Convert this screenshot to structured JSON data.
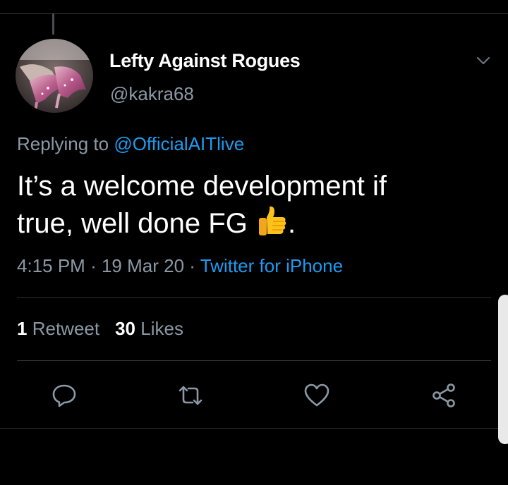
{
  "author": {
    "display_name": "Lefty Against Rogues",
    "handle": "@kakra68",
    "avatar_icon": "profile-photo-glitter-heels"
  },
  "reply": {
    "prefix": "Replying to",
    "mention": "@OfficialAITlive"
  },
  "tweet": {
    "line1": "It’s a welcome development if",
    "line2_text": "true, well done FG",
    "emoji": "thumbs-up-icon",
    "line2_suffix": "."
  },
  "meta": {
    "time": "4:15 PM",
    "separator1": "·",
    "date": "19 Mar 20",
    "separator2": "·",
    "source": "Twitter for iPhone"
  },
  "stats": {
    "retweet_count": "1",
    "retweet_label": "Retweet",
    "like_count": "30",
    "like_label": "Likes"
  },
  "actions": [
    {
      "name": "reply",
      "icon": "reply-icon"
    },
    {
      "name": "retweet",
      "icon": "retweet-icon"
    },
    {
      "name": "like",
      "icon": "heart-icon"
    },
    {
      "name": "share",
      "icon": "share-icon"
    }
  ],
  "colors": {
    "background": "#000000",
    "text_primary": "#ffffff",
    "text_secondary": "#8b98a5",
    "link": "#1d9bf0",
    "divider": "#2f3336"
  }
}
